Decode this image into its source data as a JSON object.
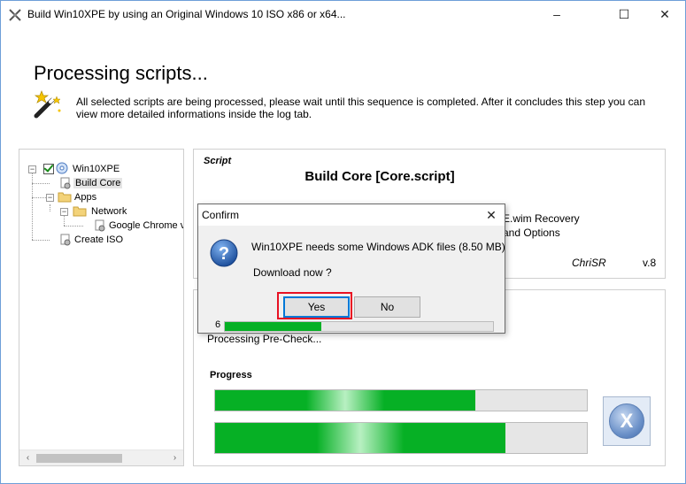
{
  "window": {
    "title": "Build Win10XPE by using an Original Windows 10 ISO x86 or x64...",
    "minimize_glyph": "–",
    "maximize_glyph": "☐",
    "close_glyph": "✕",
    "app_icon": "win10xpe-builder-icon"
  },
  "header": {
    "title": "Processing scripts...",
    "description": "All selected scripts are being processed, please wait until this sequence is completed. After it concludes this step you can view more detailed informations inside the log tab.",
    "icon": "magic-wand-icon"
  },
  "tree": {
    "nodes": [
      {
        "label": "Win10XPE",
        "checked": true,
        "expanded": true
      },
      {
        "label": "Build Core",
        "selected": true
      },
      {
        "label": "Apps",
        "expanded": true
      },
      {
        "label": "Network",
        "expanded": true
      },
      {
        "label": "Google Chrome v"
      },
      {
        "label": "Create ISO"
      }
    ],
    "scroll_left": "‹",
    "scroll_right": "›"
  },
  "script": {
    "section_label": "Script",
    "title": "Build Core [Core.script]",
    "description_line1": "E.wim Recovery",
    "description_line2": "and Options",
    "author": "ChriSR",
    "version": "v.8"
  },
  "progress": {
    "status": "Processing Pre-Check...",
    "label": "Progress",
    "bar1_fraction": 0.7,
    "bar2_fraction": 0.78,
    "cancel_glyph": "X"
  },
  "dialog": {
    "title": "Confirm",
    "close_glyph": "✕",
    "message": "Win10XPE needs some Windows ADK files (8.50 MB)",
    "question": "Download now ?",
    "yes_label": "Yes",
    "no_label": "No",
    "count": "6",
    "bar_fraction": 0.36,
    "icon": "question-icon"
  },
  "colors": {
    "progress_green": "#06b025",
    "highlight_red": "#e81123",
    "focus_blue": "#0078d7"
  }
}
